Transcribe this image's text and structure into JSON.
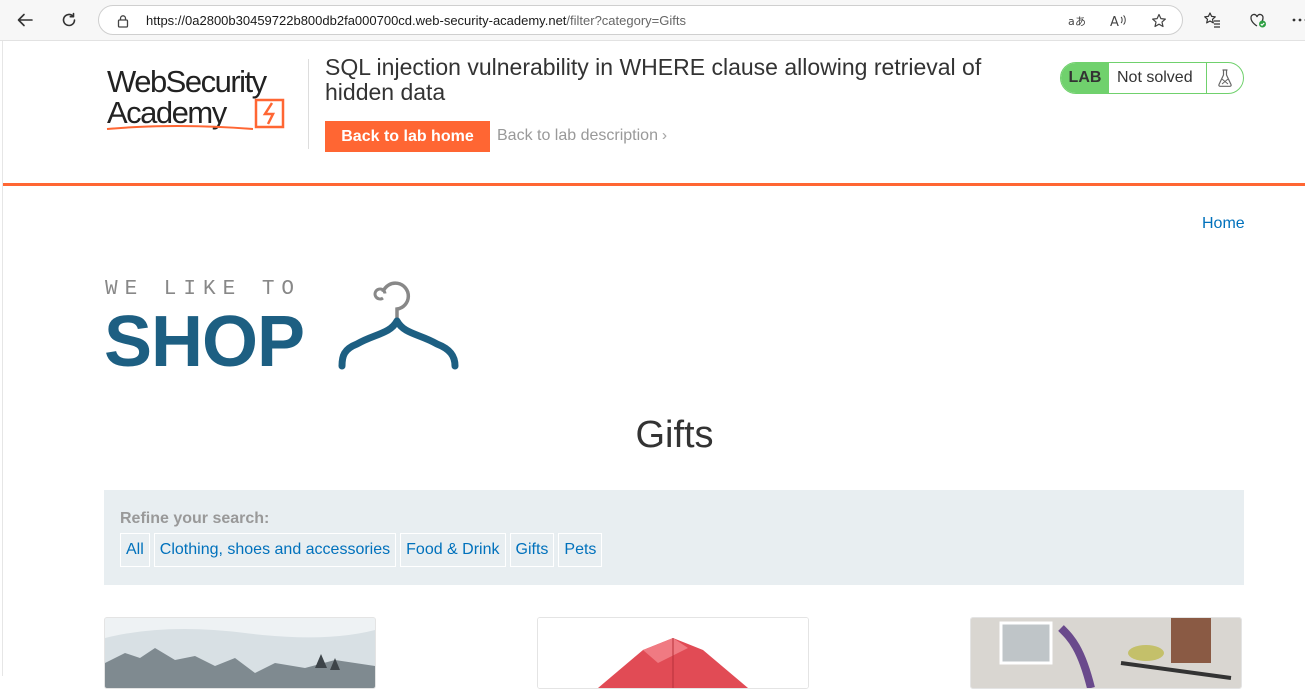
{
  "browser": {
    "url_host": "https://0a2800b30459722b800db2fa000700cd.web-security-academy.net",
    "url_path": "/filter?category=Gifts"
  },
  "header": {
    "logo_line1": "WebSecurity",
    "logo_line2": "Academy",
    "lab_title": "SQL injection vulnerability in WHERE clause allowing retrieval of hidden data",
    "back_home_label": "Back to lab home",
    "back_desc_label": "Back to lab description",
    "lab_badge": "LAB",
    "lab_status": "Not solved",
    "accent_color": "#ff6633",
    "status_color": "#70d16d"
  },
  "nav": {
    "home_label": "Home"
  },
  "shop_logo": {
    "tagline": "WE LIKE TO",
    "brand": "SHOP"
  },
  "main": {
    "heading": "Gifts",
    "filter_label": "Refine your search:",
    "filters": [
      "All",
      "Clothing, shoes and accessories",
      "Food & Drink",
      "Gifts",
      "Pets"
    ]
  }
}
